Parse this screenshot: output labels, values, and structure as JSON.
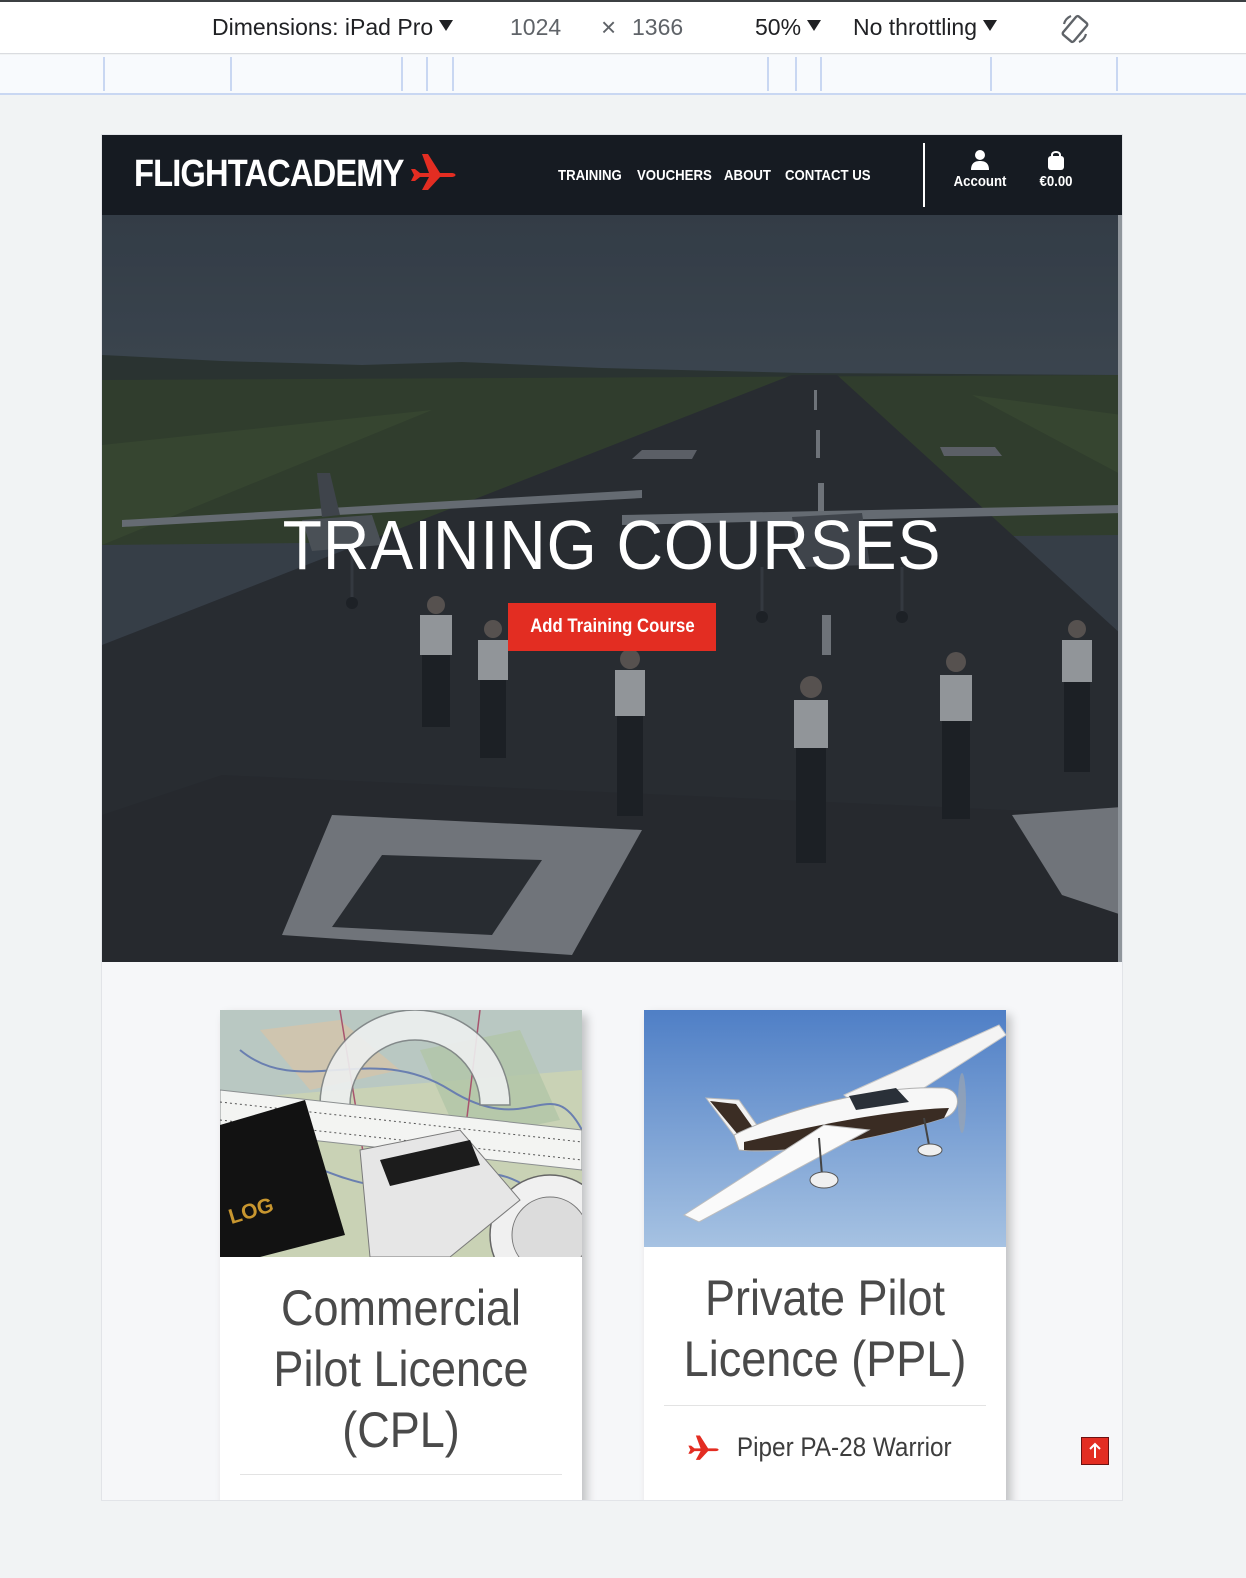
{
  "devtools": {
    "dimensions_label": "Dimensions: iPad Pro",
    "width": "1024",
    "times": "×",
    "height": "1366",
    "zoom": "50%",
    "throttling": "No throttling",
    "rotate_icon": "rotate-icon"
  },
  "site": {
    "logo_text": "FLIGHTACADEMY",
    "logo_icon": "airplane-icon",
    "brand_color": "#e32d22",
    "nav": [
      "TRAINING",
      "VOUCHERS",
      "ABOUT",
      "CONTACT US"
    ],
    "account_label": "Account",
    "account_icon": "user-icon",
    "cart_label": "€0.00",
    "cart_icon": "shopping-bag-icon"
  },
  "hero": {
    "title": "TRAINING COURSES",
    "button_label": "Add Training Course"
  },
  "cards": [
    {
      "title_lines": [
        "Commercial",
        "Pilot Licence",
        "(CPL)"
      ],
      "image_text": "LOG"
    },
    {
      "title_lines": [
        "Private Pilot",
        "Licence (PPL)"
      ],
      "aircraft": "Piper PA-28 Warrior"
    }
  ],
  "back_to_top_icon": "arrow-up-icon"
}
